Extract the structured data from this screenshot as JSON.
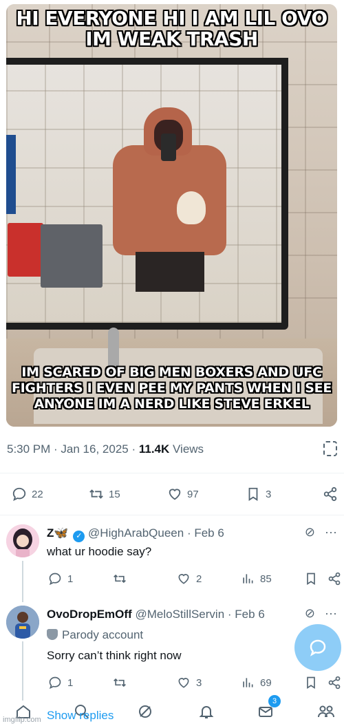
{
  "meme": {
    "top_text": "HI EVERYONE HI I AM LIL OVO IM WEAK TRASH",
    "bottom_text": "IM SCARED OF BIG MEN BOXERS AND UFC FIGHTERS I EVEN PEE MY PANTS WHEN I SEE ANYONE IM A NERD LIKE STEVE ERKEL"
  },
  "tweet": {
    "time": "5:30 PM",
    "date": "Jan 16, 2025",
    "views_count": "11.4K",
    "views_label": "Views",
    "replies": "22",
    "reposts": "15",
    "likes": "97",
    "bookmarks": "3"
  },
  "replies": [
    {
      "name": "Z🦋",
      "handle": "@HighArabQueen",
      "date": "Feb 6",
      "text": "what ur hoodie say?",
      "reply_count": "1",
      "repost_count": "",
      "like_count": "2",
      "view_count": "85"
    },
    {
      "name": "OvoDropEmOff",
      "handle": "@MeloStillServin",
      "date": "Feb 6",
      "badge": "Parody account",
      "text": "Sorry can’t think right now",
      "reply_count": "1",
      "repost_count": "",
      "like_count": "3",
      "view_count": "69"
    }
  ],
  "show_replies": "Show replies",
  "nav": {
    "messages_badge": "3"
  },
  "watermark": "imgflip.com",
  "colors": {
    "accent": "#1d9bf0",
    "muted": "#536471",
    "text": "#0f1419"
  }
}
